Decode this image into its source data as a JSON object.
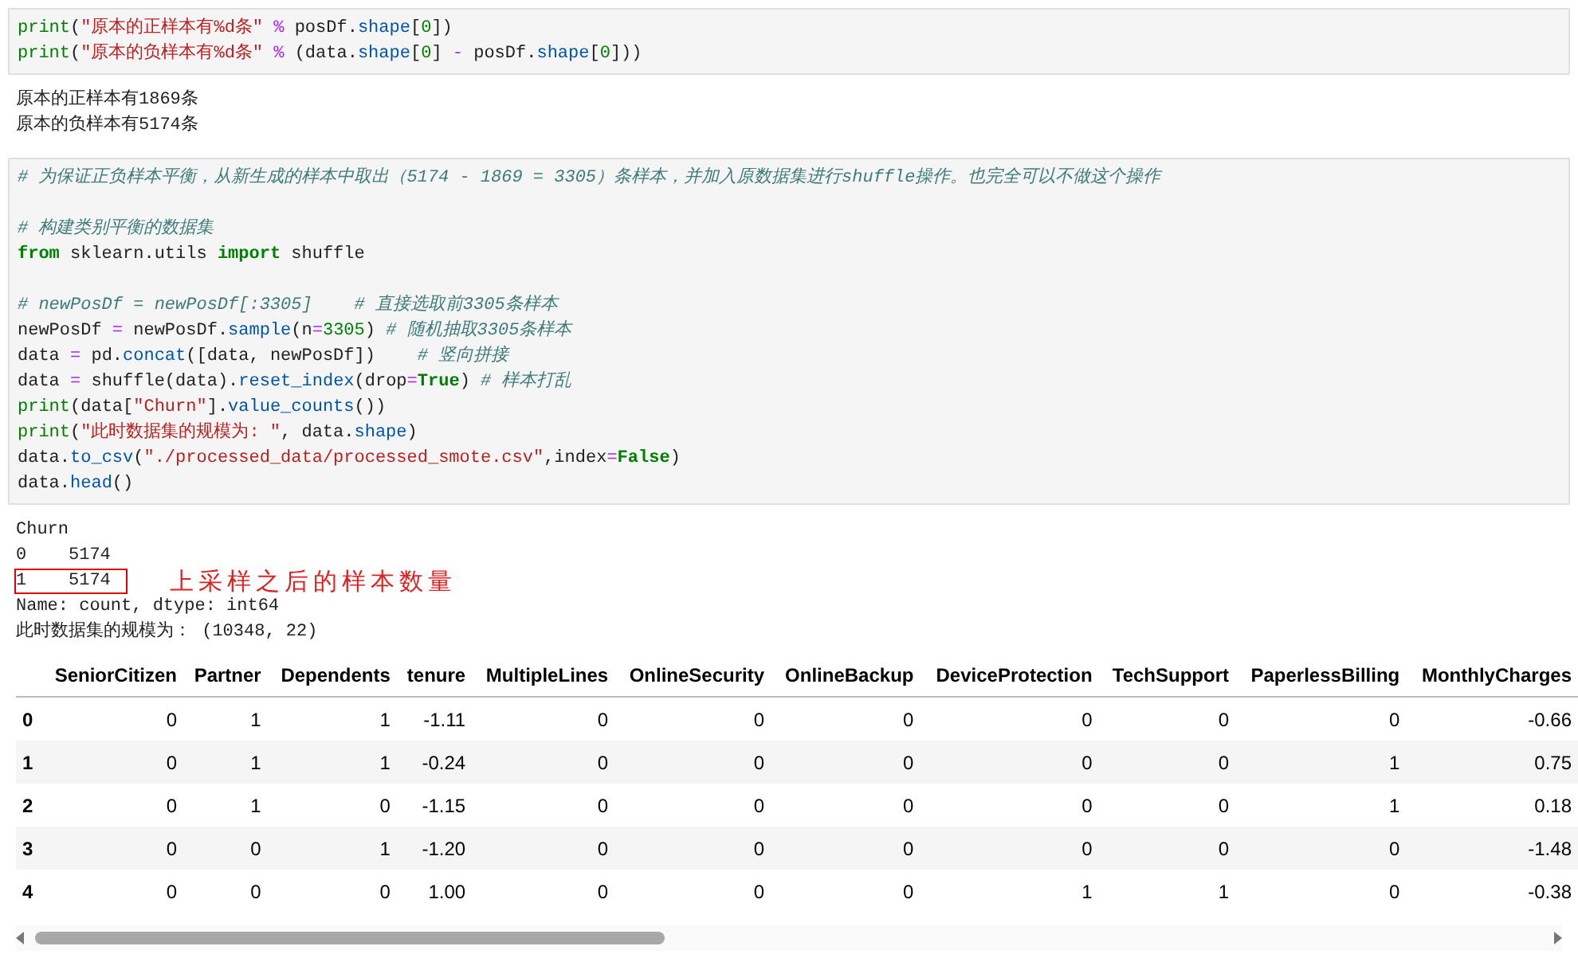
{
  "cells": [
    {
      "code": [
        {
          "kind": "code",
          "tokens": [
            {
              "kind": "fn",
              "text": "print"
            },
            {
              "kind": "plain",
              "text": "("
            },
            {
              "kind": "str",
              "text": "\"原本的正样本有%d条\""
            },
            {
              "kind": "op",
              "text": " %"
            },
            {
              "kind": "plain",
              "text": " posDf."
            },
            {
              "kind": "attr",
              "text": "shape"
            },
            {
              "kind": "plain",
              "text": "["
            },
            {
              "kind": "num",
              "text": "0"
            },
            {
              "kind": "plain",
              "text": "])"
            }
          ]
        },
        {
          "kind": "code",
          "tokens": [
            {
              "kind": "fn",
              "text": "print"
            },
            {
              "kind": "plain",
              "text": "("
            },
            {
              "kind": "str",
              "text": "\"原本的负样本有%d条\""
            },
            {
              "kind": "op",
              "text": " %"
            },
            {
              "kind": "plain",
              "text": " (data."
            },
            {
              "kind": "attr",
              "text": "shape"
            },
            {
              "kind": "plain",
              "text": "["
            },
            {
              "kind": "num",
              "text": "0"
            },
            {
              "kind": "plain",
              "text": "] "
            },
            {
              "kind": "op",
              "text": "-"
            },
            {
              "kind": "plain",
              "text": " posDf."
            },
            {
              "kind": "attr",
              "text": "shape"
            },
            {
              "kind": "plain",
              "text": "["
            },
            {
              "kind": "num",
              "text": "0"
            },
            {
              "kind": "plain",
              "text": "]))"
            }
          ]
        }
      ],
      "output": [
        {
          "text": "原本的正样本有1869条",
          "highlighted": false
        },
        {
          "text": "原本的负样本有5174条",
          "highlighted": false
        }
      ]
    },
    {
      "code": [
        {
          "kind": "code",
          "tokens": [
            {
              "kind": "com",
              "text": "# 为保证正负样本平衡，从新生成的样本中取出（5174 - 1869 = 3305）条样本，并加入原数据集进行shuffle操作。也完全可以不做这个操作"
            }
          ]
        },
        {
          "kind": "blank"
        },
        {
          "kind": "code",
          "tokens": [
            {
              "kind": "com",
              "text": "# 构建类别平衡的数据集"
            }
          ]
        },
        {
          "kind": "code",
          "tokens": [
            {
              "kind": "kw",
              "text": "from"
            },
            {
              "kind": "plain",
              "text": " sklearn.utils "
            },
            {
              "kind": "kw",
              "text": "import"
            },
            {
              "kind": "plain",
              "text": " shuffle"
            }
          ]
        },
        {
          "kind": "blank"
        },
        {
          "kind": "code",
          "tokens": [
            {
              "kind": "com",
              "text": "# newPosDf = newPosDf[:3305]    # 直接选取前3305条样本"
            }
          ]
        },
        {
          "kind": "code",
          "tokens": [
            {
              "kind": "plain",
              "text": "newPosDf "
            },
            {
              "kind": "op",
              "text": "="
            },
            {
              "kind": "plain",
              "text": " newPosDf."
            },
            {
              "kind": "attr",
              "text": "sample"
            },
            {
              "kind": "plain",
              "text": "(n"
            },
            {
              "kind": "op",
              "text": "="
            },
            {
              "kind": "num",
              "text": "3305"
            },
            {
              "kind": "plain",
              "text": ") "
            },
            {
              "kind": "com",
              "text": "# 随机抽取3305条样本"
            }
          ]
        },
        {
          "kind": "code",
          "tokens": [
            {
              "kind": "plain",
              "text": "data "
            },
            {
              "kind": "op",
              "text": "="
            },
            {
              "kind": "plain",
              "text": " pd."
            },
            {
              "kind": "attr",
              "text": "concat"
            },
            {
              "kind": "plain",
              "text": "([data, newPosDf])    "
            },
            {
              "kind": "com",
              "text": "# 竖向拼接"
            }
          ]
        },
        {
          "kind": "code",
          "tokens": [
            {
              "kind": "plain",
              "text": "data "
            },
            {
              "kind": "op",
              "text": "="
            },
            {
              "kind": "plain",
              "text": " shuffle(data)."
            },
            {
              "kind": "attr",
              "text": "reset_index"
            },
            {
              "kind": "plain",
              "text": "(drop"
            },
            {
              "kind": "op",
              "text": "="
            },
            {
              "kind": "kw",
              "text": "True"
            },
            {
              "kind": "plain",
              "text": ") "
            },
            {
              "kind": "com",
              "text": "# 样本打乱"
            }
          ]
        },
        {
          "kind": "code",
          "tokens": [
            {
              "kind": "fn",
              "text": "print"
            },
            {
              "kind": "plain",
              "text": "(data["
            },
            {
              "kind": "str",
              "text": "\"Churn\""
            },
            {
              "kind": "plain",
              "text": "]."
            },
            {
              "kind": "attr",
              "text": "value_counts"
            },
            {
              "kind": "plain",
              "text": "())"
            }
          ]
        },
        {
          "kind": "code",
          "tokens": [
            {
              "kind": "fn",
              "text": "print"
            },
            {
              "kind": "plain",
              "text": "("
            },
            {
              "kind": "str",
              "text": "\"此时数据集的规模为: \""
            },
            {
              "kind": "plain",
              "text": ", data."
            },
            {
              "kind": "attr",
              "text": "shape"
            },
            {
              "kind": "plain",
              "text": ")"
            }
          ]
        },
        {
          "kind": "code",
          "tokens": [
            {
              "kind": "plain",
              "text": "data."
            },
            {
              "kind": "attr",
              "text": "to_csv"
            },
            {
              "kind": "plain",
              "text": "("
            },
            {
              "kind": "str",
              "text": "\"./processed_data/processed_smote.csv\""
            },
            {
              "kind": "plain",
              "text": ",index"
            },
            {
              "kind": "op",
              "text": "="
            },
            {
              "kind": "kw",
              "text": "False"
            },
            {
              "kind": "plain",
              "text": ")"
            }
          ]
        },
        {
          "kind": "code",
          "tokens": [
            {
              "kind": "plain",
              "text": "data."
            },
            {
              "kind": "attr",
              "text": "head"
            },
            {
              "kind": "plain",
              "text": "()"
            }
          ]
        }
      ],
      "output": [
        {
          "text": "Churn",
          "highlighted": false
        },
        {
          "text": "0    5174",
          "highlighted": false
        },
        {
          "text": "1    5174",
          "highlighted": true,
          "annotation": "上采样之后的样本数量"
        },
        {
          "text": "Name: count, dtype: int64",
          "highlighted": false
        },
        {
          "text": "此时数据集的规模为： (10348, 22)",
          "highlighted": false
        }
      ],
      "table": {
        "columns": [
          "SeniorCitizen",
          "Partner",
          "Dependents",
          "tenure",
          "MultipleLines",
          "OnlineSecurity",
          "OnlineBackup",
          "DeviceProtection",
          "TechSupport",
          "PaperlessBilling",
          "MonthlyCharges"
        ],
        "rows": [
          {
            "index": "0",
            "cells": [
              "0",
              "1",
              "1",
              "-1.11",
              "0",
              "0",
              "0",
              "0",
              "0",
              "0",
              "-0.66"
            ]
          },
          {
            "index": "1",
            "cells": [
              "0",
              "1",
              "1",
              "-0.24",
              "0",
              "0",
              "0",
              "0",
              "0",
              "1",
              "0.75"
            ]
          },
          {
            "index": "2",
            "cells": [
              "0",
              "1",
              "0",
              "-1.15",
              "0",
              "0",
              "0",
              "0",
              "0",
              "1",
              "0.18"
            ]
          },
          {
            "index": "3",
            "cells": [
              "0",
              "0",
              "1",
              "-1.20",
              "0",
              "0",
              "0",
              "0",
              "0",
              "0",
              "-1.48"
            ]
          },
          {
            "index": "4",
            "cells": [
              "0",
              "0",
              "0",
              "1.00",
              "0",
              "0",
              "0",
              "1",
              "1",
              "0",
              "-0.38"
            ]
          }
        ]
      }
    }
  ]
}
